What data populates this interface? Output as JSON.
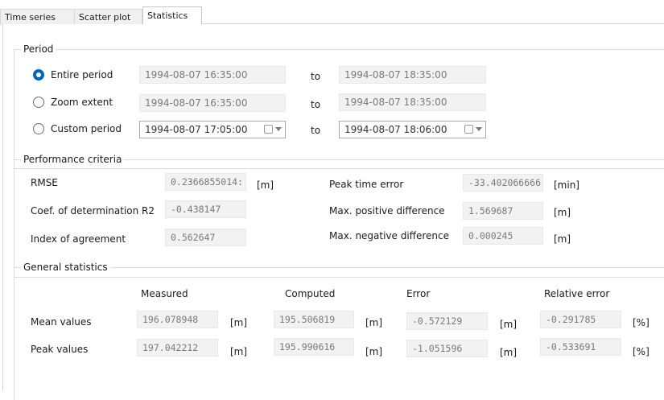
{
  "tabs": [
    {
      "label": "Time series"
    },
    {
      "label": "Scatter plot"
    },
    {
      "label": "Statistics"
    }
  ],
  "period": {
    "title": "Period",
    "to_label": "to",
    "rows": [
      {
        "label": "Entire period",
        "selected": true,
        "from": "1994-08-07 16:35:00",
        "to": "1994-08-07 18:35:00"
      },
      {
        "label": "Zoom extent",
        "selected": false,
        "from": "1994-08-07 16:35:00",
        "to": "1994-08-07 18:35:00"
      },
      {
        "label": "Custom period",
        "selected": false,
        "from": "1994-08-07 17:05:00",
        "to": "1994-08-07 18:06:00"
      }
    ]
  },
  "performance": {
    "title": "Performance criteria",
    "rmse": {
      "label": "RMSE",
      "value": "0.2366855014:",
      "unit": "[m]"
    },
    "r2": {
      "label": "Coef. of determination R2",
      "value": "-0.438147"
    },
    "ioa": {
      "label": "Index of agreement",
      "value": "0.562647"
    },
    "peak_time_error": {
      "label": "Peak time error",
      "value": "-33.402066666",
      "unit": "[min]"
    },
    "max_pos": {
      "label": "Max. positive difference",
      "value": "1.569687",
      "unit": "[m]"
    },
    "max_neg": {
      "label": "Max. negative difference",
      "value": "0.000245",
      "unit": "[m]"
    }
  },
  "general": {
    "title": "General statistics",
    "headers": {
      "measured": "Measured",
      "computed": "Computed",
      "error": "Error",
      "relative": "Relative error"
    },
    "mean": {
      "label": "Mean values",
      "measured": "196.078948",
      "measured_unit": "[m]",
      "computed": "195.506819",
      "computed_unit": "[m]",
      "error": "-0.572129",
      "error_unit": "[m]",
      "relative": "-0.291785",
      "relative_unit": "[%]"
    },
    "peak": {
      "label": "Peak values",
      "measured": "197.042212",
      "measured_unit": "[m]",
      "computed": "195.990616",
      "computed_unit": "[m]",
      "error": "-1.051596",
      "error_unit": "[m]",
      "relative": "-0.533691",
      "relative_unit": "[%]"
    }
  }
}
